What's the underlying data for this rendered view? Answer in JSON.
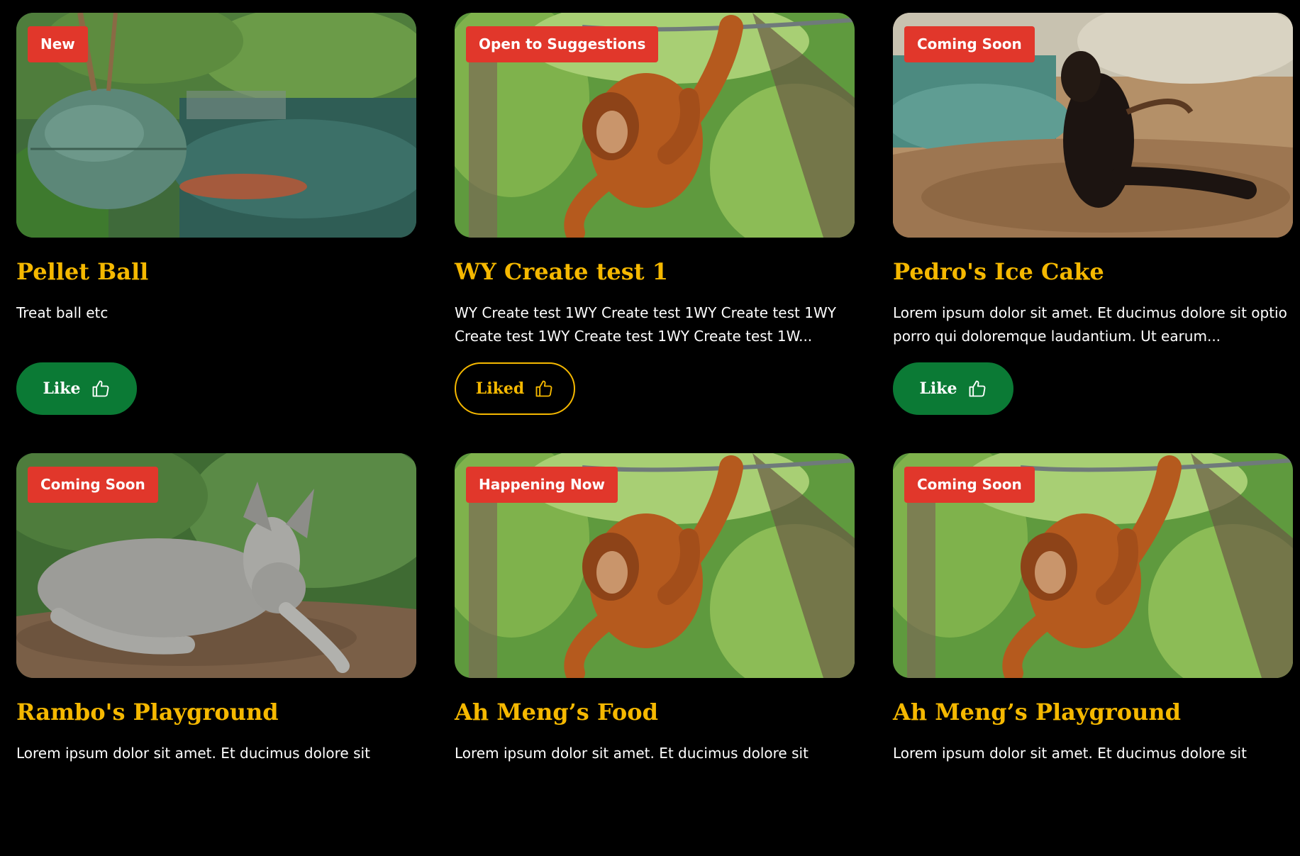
{
  "colors": {
    "background": "#000000",
    "title": "#f5b800",
    "badge": "#e1372b",
    "like_solid": "#0b7a35",
    "liked_outline": "#f5b800"
  },
  "cards": [
    {
      "badge": "New",
      "title": "Pellet Ball",
      "description": "Treat ball etc",
      "button_label": "Like",
      "liked": false,
      "image_subject": "pellet-ball-enclosure-photo"
    },
    {
      "badge": "Open to Suggestions",
      "title": "WY Create test 1",
      "description": "WY Create test 1WY Create test 1WY Create test 1WY Create test 1WY Create test 1WY Create test 1W...",
      "button_label": "Liked",
      "liked": true,
      "image_subject": "orangutan-photo"
    },
    {
      "badge": "Coming Soon",
      "title": "Pedro's Ice Cake",
      "description": "Lorem ipsum dolor sit amet. Et ducimus dolore sit optio porro qui doloremque laudantium. Ut earum...",
      "button_label": "Like",
      "liked": false,
      "image_subject": "sea-lion-photo"
    },
    {
      "badge": "Coming Soon",
      "title": "Rambo's Playground",
      "description": "Lorem ipsum dolor sit amet. Et ducimus dolore sit",
      "button_label": "",
      "liked": false,
      "image_subject": "kangaroo-photo"
    },
    {
      "badge": "Happening Now",
      "title": "Ah Meng’s Food",
      "description": "Lorem ipsum dolor sit amet. Et ducimus dolore sit",
      "button_label": "",
      "liked": false,
      "image_subject": "orangutan-photo"
    },
    {
      "badge": "Coming Soon",
      "title": "Ah Meng’s Playground",
      "description": "Lorem ipsum dolor sit amet. Et ducimus dolore sit",
      "button_label": "",
      "liked": false,
      "image_subject": "orangutan-photo"
    }
  ]
}
